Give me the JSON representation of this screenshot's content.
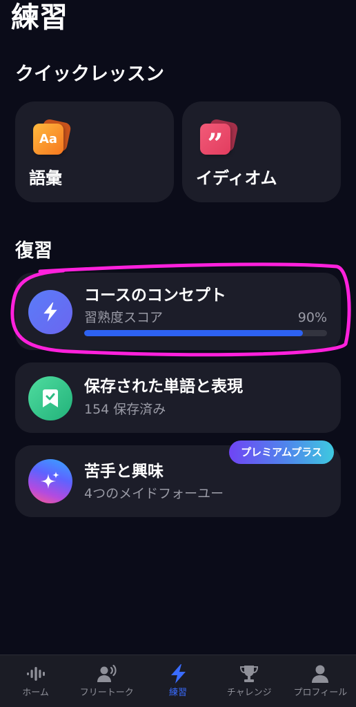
{
  "page": {
    "title": "練習"
  },
  "quick_lessons": {
    "heading": "クイックレッスン",
    "items": [
      {
        "label": "語彙",
        "icon": "vocabulary-icon",
        "icon_text": "Aa"
      },
      {
        "label": "イディオム",
        "icon": "idiom-quote-icon",
        "icon_text": "”"
      }
    ]
  },
  "review": {
    "heading": "復習",
    "items": [
      {
        "title": "コースのコンセプト",
        "subtitle": "習熟度スコア",
        "score": "90%",
        "progress": 0.9,
        "icon": "lightning-icon"
      },
      {
        "title": "保存された単語と表現",
        "subtitle": "154 保存済み",
        "icon": "bookmark-icon"
      },
      {
        "title": "苦手と興味",
        "subtitle": "4つのメイドフォーユー",
        "badge": "プレミアムプラス",
        "icon": "sparkle-icon"
      }
    ]
  },
  "bottom_nav": {
    "items": [
      {
        "label": "ホーム",
        "icon": "waveform-icon",
        "active": false
      },
      {
        "label": "フリートーク",
        "icon": "speaking-person-icon",
        "active": false
      },
      {
        "label": "練習",
        "icon": "lightning-icon",
        "active": true
      },
      {
        "label": "チャレンジ",
        "icon": "trophy-icon",
        "active": false
      },
      {
        "label": "プロフィール",
        "icon": "person-icon",
        "active": false
      }
    ]
  },
  "colors": {
    "background": "#0b0c19",
    "card": "#1c1d29",
    "muted_text": "#9a9ba6",
    "progress_track": "#33343f",
    "progress_fill": "#2d62f2",
    "nav_background": "#1b1c25",
    "nav_inactive": "#8f9099",
    "nav_active": "#3a6cff",
    "highlight_annotation": "#ff21dc"
  }
}
